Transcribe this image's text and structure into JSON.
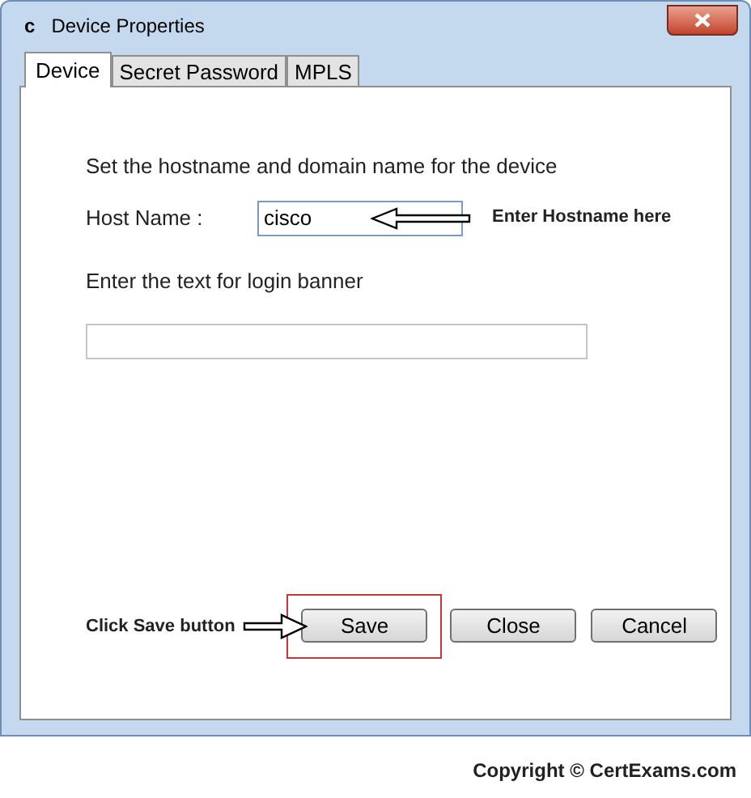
{
  "window": {
    "icon_letter": "c",
    "title": "Device Properties"
  },
  "tabs": [
    {
      "label": "Device",
      "selected": true
    },
    {
      "label": "Secret Password",
      "selected": false
    },
    {
      "label": "MPLS",
      "selected": false
    }
  ],
  "intro": "Set the hostname and domain name for the device",
  "hostname": {
    "label": "Host Name :",
    "value": "cisco",
    "note": "Enter Hostname here"
  },
  "banner": {
    "label": "Enter the text for login banner"
  },
  "save_note": "Click Save button",
  "buttons": [
    {
      "label": "Save",
      "highlighted": true
    },
    {
      "label": "Close",
      "highlighted": false
    },
    {
      "label": "Cancel",
      "highlighted": false
    }
  ],
  "footer": "Copyright © CertExams.com"
}
